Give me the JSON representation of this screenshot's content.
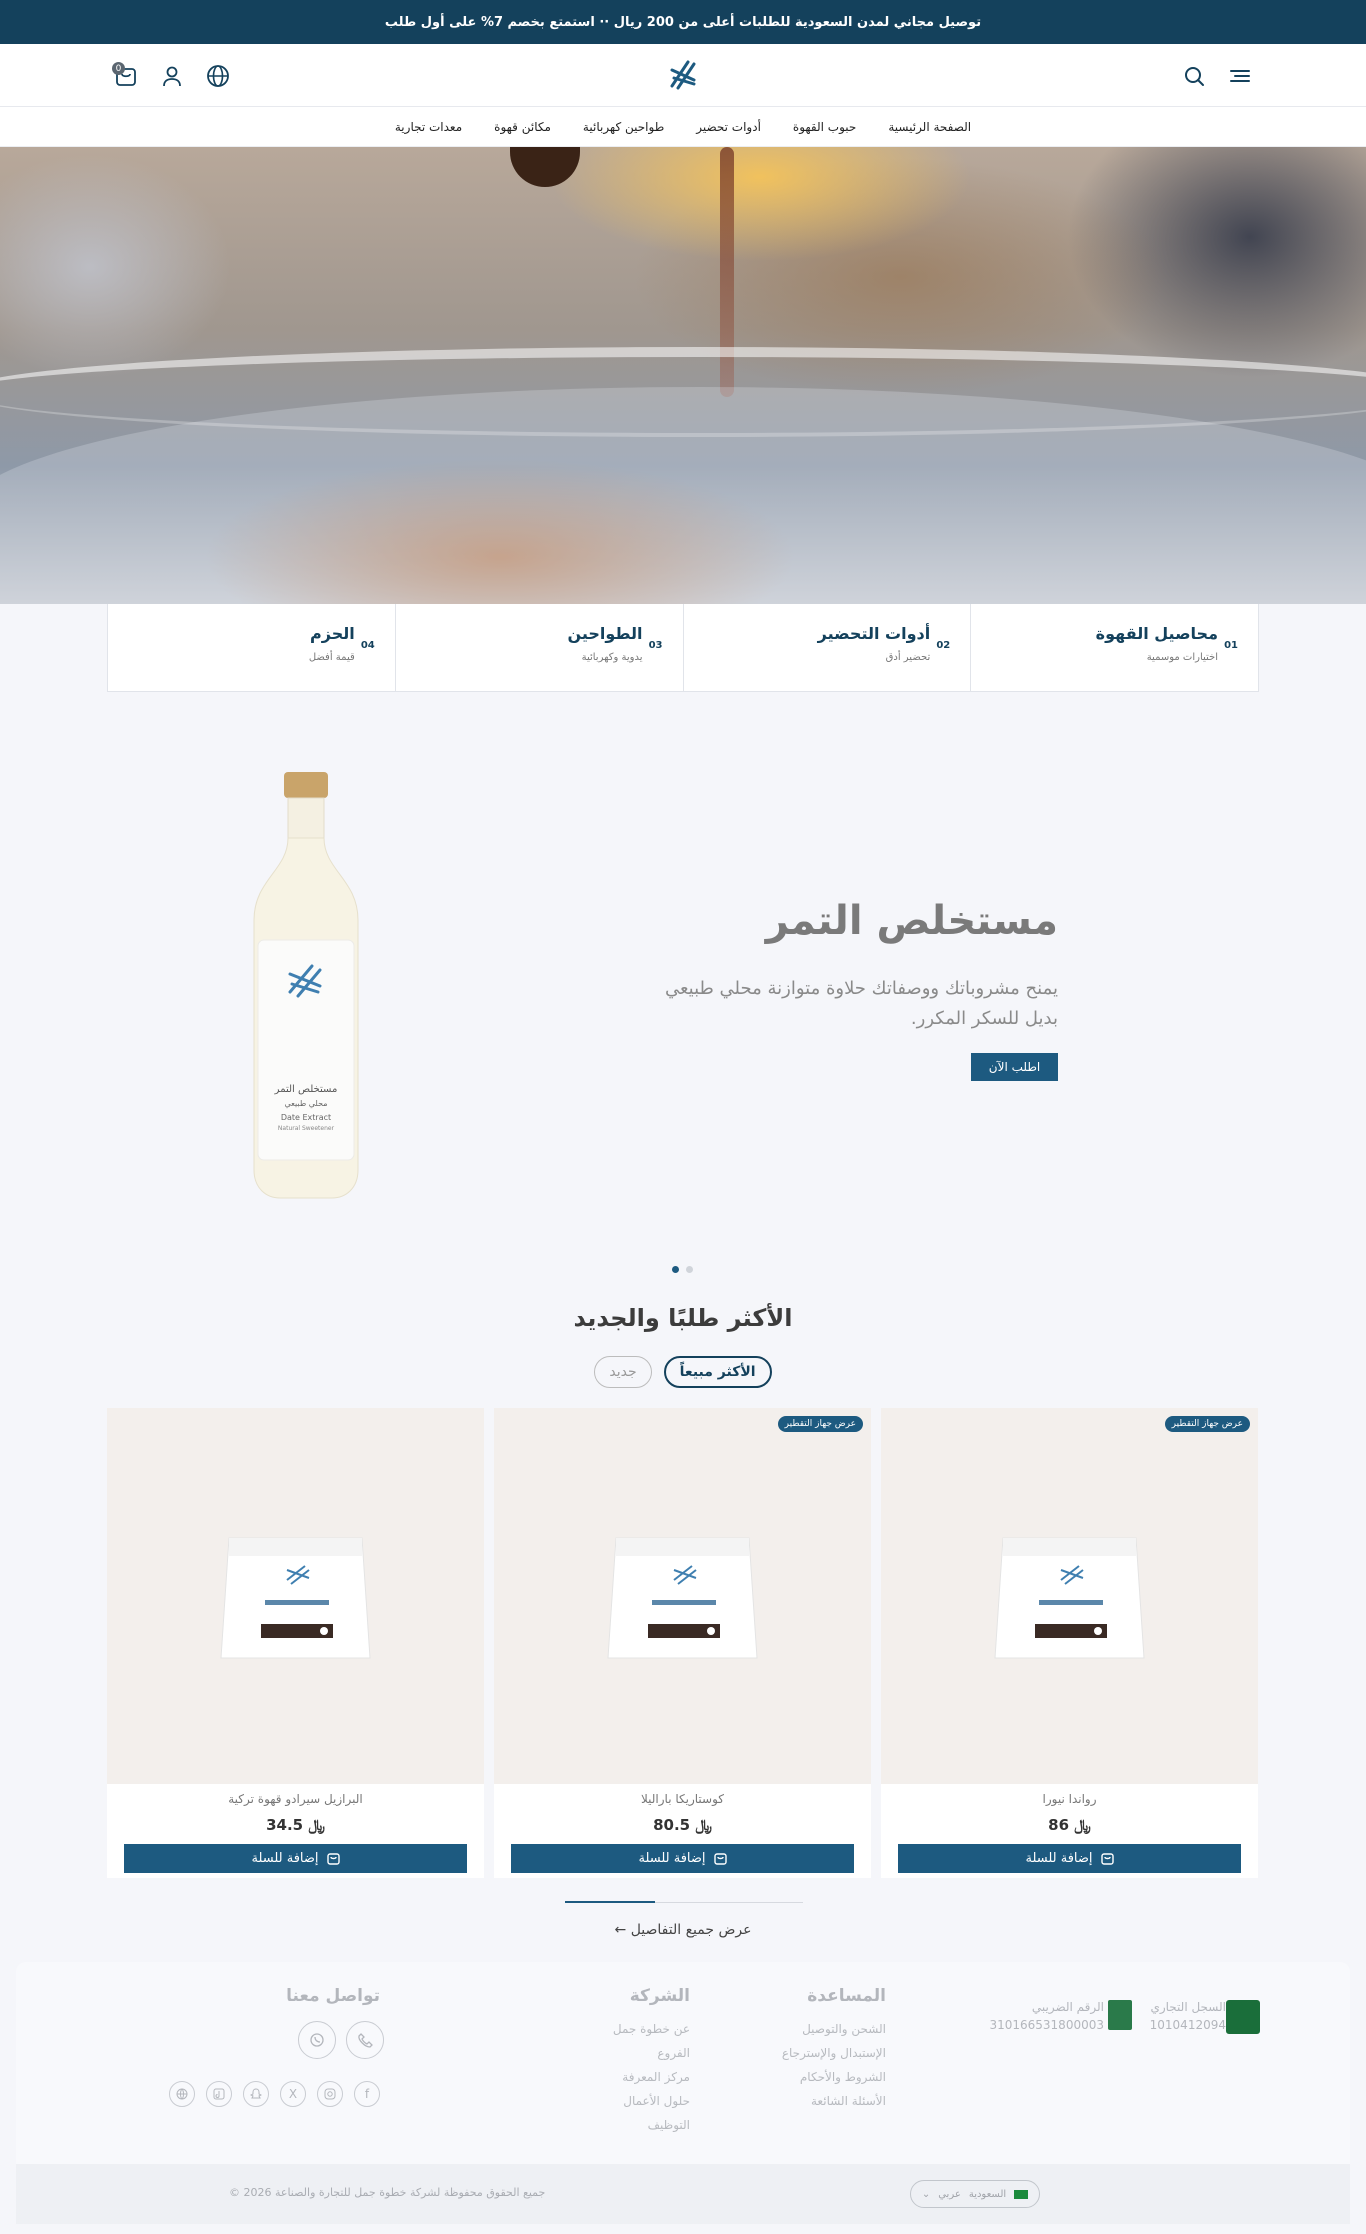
{
  "announcement": "توصيل مجاني لمدن السعودية للطلبات أعلى من 200 ريال ·· استمتع بخصم 7% على أول طلب",
  "header": {
    "cart_count": "0"
  },
  "nav": [
    "الصفحة الرئيسية",
    "حبوب القهوة",
    "أدوات تحضير",
    "طواحين كهربائية",
    "مكائن قهوة",
    "معدات تجارية"
  ],
  "categories": [
    {
      "num": "01",
      "title": "محاصيل القهوة",
      "sub": "اختيارات موسمية"
    },
    {
      "num": "02",
      "title": "أدوات التحضير",
      "sub": "تحضير أدق"
    },
    {
      "num": "03",
      "title": "الطواحين",
      "sub": "يدوية وكهربائية"
    },
    {
      "num": "04",
      "title": "الحزم",
      "sub": "قيمة أفضل"
    }
  ],
  "slide": {
    "title": "مستخلص التمر",
    "desc": "يمنح مشروباتك ووصفاتك حلاوة متوازنة محلي طبيعي بديل للسكر المكرر.",
    "cta": "اطلب الآن",
    "bottle_label": "مستخلص التمر",
    "bottle_sub": "محلي طبيعي",
    "bottle_en": "Date Extract",
    "bottle_en_sub": "Natural Sweetener"
  },
  "section": {
    "title": "الأكثر طلبًا والجديد",
    "tab_best": "الأكثر مبيعاً",
    "tab_new": "جديد"
  },
  "products": [
    {
      "name": "رواندا نيورا",
      "price": "86",
      "badge": "عرض جهاز التقطير",
      "add": "إضافة للسلة"
    },
    {
      "name": "كوستاريكا باراليلا",
      "price": "80.5",
      "badge": "عرض جهاز التقطير",
      "add": "إضافة للسلة"
    },
    {
      "name": "البرازيل سيرادو قهوة تركية",
      "price": "34.5",
      "badge": "",
      "add": "إضافة للسلة"
    }
  ],
  "more": "عرض جميع التفاصيل",
  "footer": {
    "cr_label": "السجل التجاري",
    "cr_num": "1010412094",
    "tax_label": "الرقم الضريبي",
    "tax_num": "310166531800003",
    "help_title": "المساعدة",
    "help_links": [
      "الشحن والتوصيل",
      "الإستبدال والإسترجاع",
      "الشروط والأحكام",
      "الأسئلة الشائعة"
    ],
    "company_title": "الشركة",
    "company_links": [
      "عن خطوة جمل",
      "الفروع",
      "مركز المعرفة",
      "حلول الأعمال",
      "التوظيف"
    ],
    "contact_title": "تواصل معنا",
    "copyright": "جميع الحقوق محفوظة لشركة خطوة جمل للتجارة والصناعة 2026 ©",
    "locale_country": "السعودية",
    "locale_lang": "عربي"
  },
  "colors": {
    "primary": "#14415c",
    "button": "#1d5a80"
  }
}
